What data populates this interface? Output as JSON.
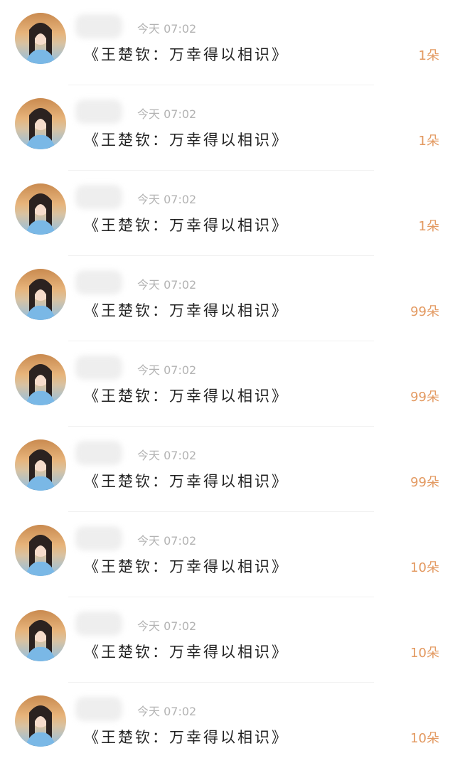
{
  "items": [
    {
      "time": "今天 07:02",
      "title": "《王楚钦：万幸得以相识》",
      "amount": "1朵"
    },
    {
      "time": "今天 07:02",
      "title": "《王楚钦：万幸得以相识》",
      "amount": "1朵"
    },
    {
      "time": "今天 07:02",
      "title": "《王楚钦：万幸得以相识》",
      "amount": "1朵"
    },
    {
      "time": "今天 07:02",
      "title": "《王楚钦：万幸得以相识》",
      "amount": "99朵"
    },
    {
      "time": "今天 07:02",
      "title": "《王楚钦：万幸得以相识》",
      "amount": "99朵"
    },
    {
      "time": "今天 07:02",
      "title": "《王楚钦：万幸得以相识》",
      "amount": "99朵"
    },
    {
      "time": "今天 07:02",
      "title": "《王楚钦：万幸得以相识》",
      "amount": "10朵"
    },
    {
      "time": "今天 07:02",
      "title": "《王楚钦：万幸得以相识》",
      "amount": "10朵"
    },
    {
      "time": "今天 07:02",
      "title": "《王楚钦：万幸得以相识》",
      "amount": "10朵"
    }
  ],
  "colors": {
    "amount": "#e39a62",
    "time": "#b3b3b3",
    "title": "#222222"
  }
}
